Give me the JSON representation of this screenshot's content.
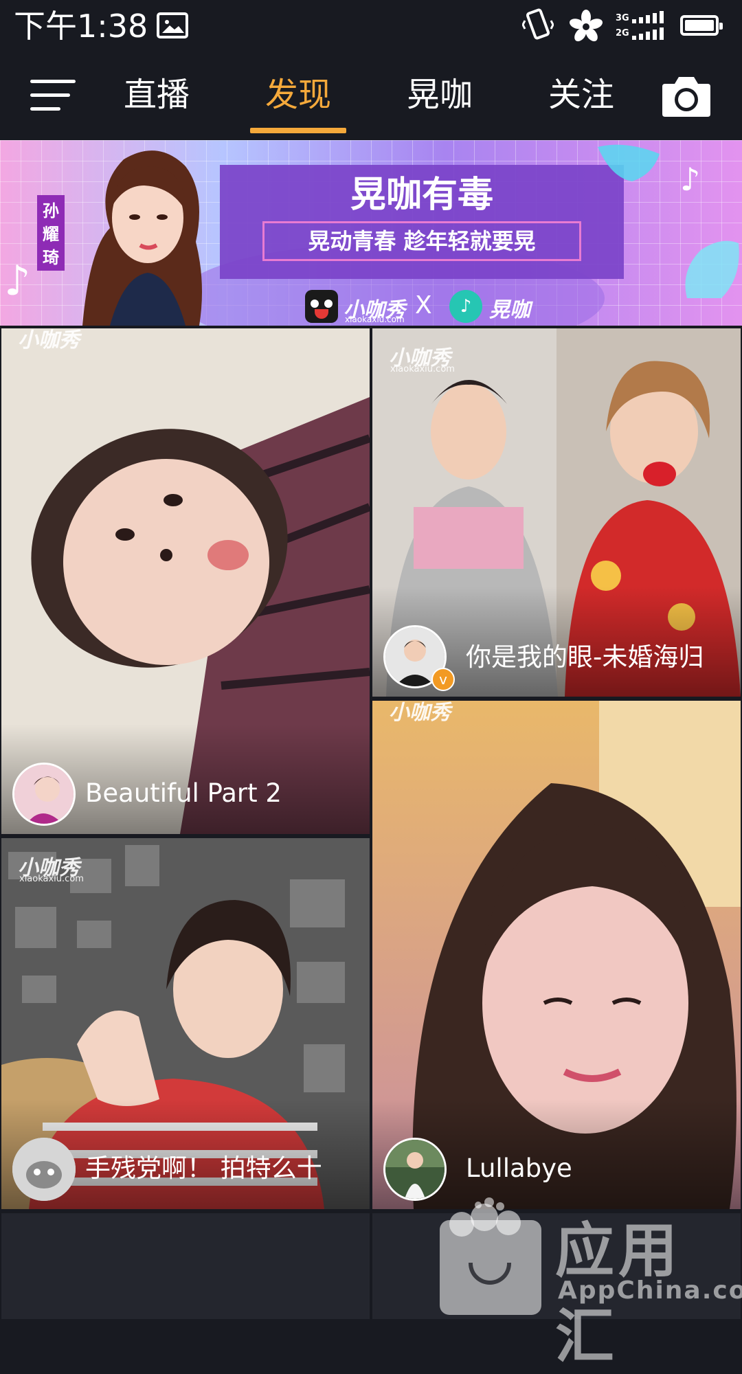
{
  "status_bar": {
    "time": "下午1:38",
    "network_top": "3G",
    "network_bottom": "2G",
    "icons": [
      "gallery-icon",
      "vibrate-icon",
      "flower-icon",
      "signal-icon",
      "battery-icon"
    ]
  },
  "nav": {
    "tabs": [
      {
        "label": "直播",
        "active": false
      },
      {
        "label": "发现",
        "active": true
      },
      {
        "label": "晃咖",
        "active": false
      },
      {
        "label": "关注",
        "active": false
      }
    ],
    "accent_color": "#f5a93b",
    "left_icon": "menu-icon",
    "right_icon": "camera-icon"
  },
  "banner": {
    "person_name": "孙耀琦",
    "title": "晃咖有毒",
    "subtitle": "晃动青春 趁年轻就要晃",
    "brand1": "小咖秀",
    "brand1_domain": "xiaokaxiu.com",
    "separator": "X",
    "brand2": "晃咖"
  },
  "feed": {
    "watermark_brand": "小咖秀",
    "watermark_domain": "xiaokaxiu.com",
    "cards": [
      {
        "caption": "Beautiful  Part 2"
      },
      {
        "caption": "你是我的眼-未婚海归",
        "verified_badge": "v"
      },
      {
        "caption": "手残党啊！ 拍特么十"
      },
      {
        "caption": "Lullabye"
      }
    ]
  },
  "overlay_watermark": {
    "cn": "应用汇",
    "en": "AppChina.com"
  }
}
